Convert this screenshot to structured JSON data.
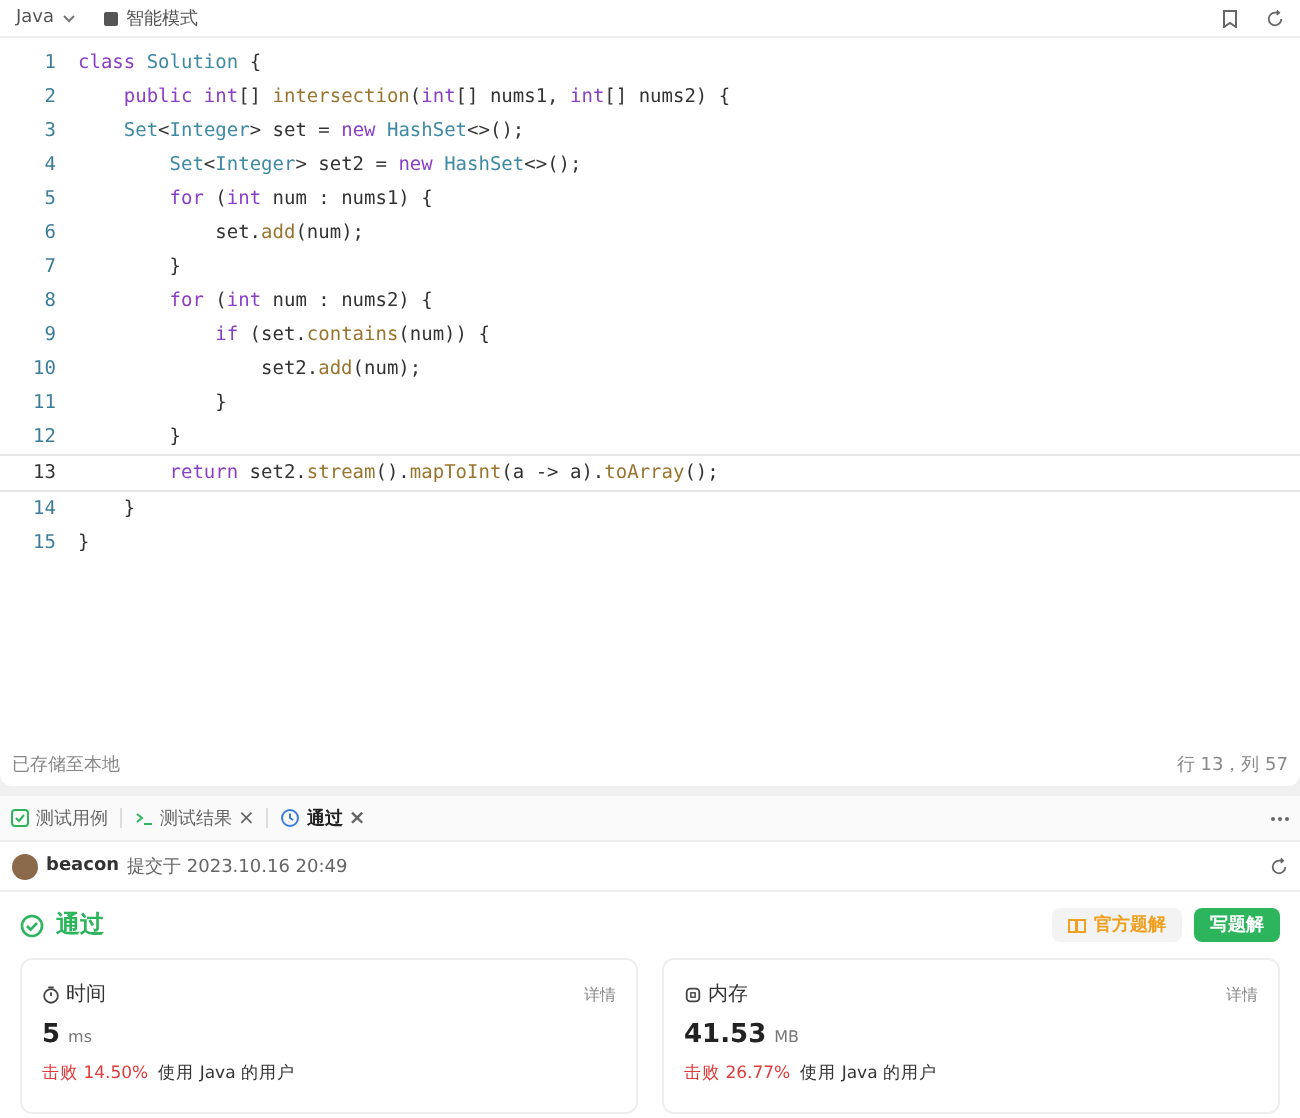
{
  "toolbar": {
    "language": "Java",
    "mode": "智能模式"
  },
  "editor": {
    "lines": [
      {
        "number": "1",
        "selected": false,
        "tokens": [
          {
            "kind": "keyword",
            "text": "class "
          },
          {
            "kind": "type",
            "text": "Solution"
          },
          {
            "kind": "plain",
            "text": " {"
          }
        ]
      },
      {
        "number": "2",
        "selected": false,
        "tokens": [
          {
            "kind": "keyword",
            "text": "    public int"
          },
          {
            "kind": "plain",
            "text": "[] "
          },
          {
            "kind": "method",
            "text": "intersection"
          },
          {
            "kind": "plain",
            "text": "("
          },
          {
            "kind": "keyword",
            "text": "int"
          },
          {
            "kind": "plain",
            "text": "[] nums1, "
          },
          {
            "kind": "keyword",
            "text": "int"
          },
          {
            "kind": "plain",
            "text": "[] nums2) {"
          }
        ]
      },
      {
        "number": "3",
        "selected": false,
        "tokens": [
          {
            "kind": "type",
            "text": "    Set"
          },
          {
            "kind": "plain",
            "text": "<"
          },
          {
            "kind": "type",
            "text": "Integer"
          },
          {
            "kind": "plain",
            "text": "> set = "
          },
          {
            "kind": "keyword",
            "text": "new "
          },
          {
            "kind": "type",
            "text": "HashSet"
          },
          {
            "kind": "plain",
            "text": "<>();"
          }
        ]
      },
      {
        "number": "4",
        "selected": false,
        "tokens": [
          {
            "kind": "type",
            "text": "        Set"
          },
          {
            "kind": "plain",
            "text": "<"
          },
          {
            "kind": "type",
            "text": "Integer"
          },
          {
            "kind": "plain",
            "text": "> set2 = "
          },
          {
            "kind": "keyword",
            "text": "new "
          },
          {
            "kind": "type",
            "text": "HashSet"
          },
          {
            "kind": "plain",
            "text": "<>();"
          }
        ]
      },
      {
        "number": "5",
        "selected": false,
        "tokens": [
          {
            "kind": "keyword",
            "text": "        for"
          },
          {
            "kind": "plain",
            "text": " ("
          },
          {
            "kind": "keyword",
            "text": "int"
          },
          {
            "kind": "plain",
            "text": " num : nums1) {"
          }
        ]
      },
      {
        "number": "6",
        "selected": false,
        "tokens": [
          {
            "kind": "plain",
            "text": "            set."
          },
          {
            "kind": "method",
            "text": "add"
          },
          {
            "kind": "plain",
            "text": "(num);"
          }
        ]
      },
      {
        "number": "7",
        "selected": false,
        "tokens": [
          {
            "kind": "plain",
            "text": "        }"
          }
        ]
      },
      {
        "number": "8",
        "selected": false,
        "tokens": [
          {
            "kind": "keyword",
            "text": "        for"
          },
          {
            "kind": "plain",
            "text": " ("
          },
          {
            "kind": "keyword",
            "text": "int"
          },
          {
            "kind": "plain",
            "text": " num : nums2) {"
          }
        ]
      },
      {
        "number": "9",
        "selected": false,
        "tokens": [
          {
            "kind": "keyword",
            "text": "            if"
          },
          {
            "kind": "plain",
            "text": " (set."
          },
          {
            "kind": "method",
            "text": "contains"
          },
          {
            "kind": "plain",
            "text": "(num)) {"
          }
        ]
      },
      {
        "number": "10",
        "selected": false,
        "tokens": [
          {
            "kind": "plain",
            "text": "                set2."
          },
          {
            "kind": "method",
            "text": "add"
          },
          {
            "kind": "plain",
            "text": "(num);"
          }
        ]
      },
      {
        "number": "11",
        "selected": false,
        "tokens": [
          {
            "kind": "plain",
            "text": "            }"
          }
        ]
      },
      {
        "number": "12",
        "selected": false,
        "tokens": [
          {
            "kind": "plain",
            "text": "        }"
          }
        ]
      },
      {
        "number": "13",
        "selected": true,
        "tokens": [
          {
            "kind": "keyword",
            "text": "        return"
          },
          {
            "kind": "plain",
            "text": " set2."
          },
          {
            "kind": "method",
            "text": "stream"
          },
          {
            "kind": "plain",
            "text": "()."
          },
          {
            "kind": "method",
            "text": "mapToInt"
          },
          {
            "kind": "plain",
            "text": "(a -> a)."
          },
          {
            "kind": "method",
            "text": "toArray"
          },
          {
            "kind": "plain",
            "text": "();"
          }
        ]
      },
      {
        "number": "14",
        "selected": false,
        "tokens": [
          {
            "kind": "plain",
            "text": "    }"
          }
        ]
      },
      {
        "number": "15",
        "selected": false,
        "tokens": [
          {
            "kind": "plain",
            "text": "}"
          }
        ]
      }
    ]
  },
  "status_bar": {
    "saved": "已存储至本地",
    "cursor": "行 13，列 57"
  },
  "tabs": [
    {
      "label": "测试用例",
      "selected": false
    },
    {
      "label": "测试结果",
      "close": "×",
      "selected": false
    },
    {
      "label": "通过",
      "close": "×",
      "selected": true
    }
  ],
  "submission": {
    "user": "beacon",
    "submitted": "提交于 2023.10.16 20:49"
  },
  "result": {
    "status": "通过",
    "buttons": [
      {
        "label": "官方题解",
        "kind": "secondary"
      },
      {
        "label": "写题解",
        "kind": "primary"
      }
    ]
  },
  "cards": [
    {
      "title": "时间",
      "detail": "详情",
      "value": "5",
      "unit": "ms",
      "beats": "击败 14.50%",
      "note": "使用 Java 的用户"
    },
    {
      "title": "内存",
      "detail": "详情",
      "value": "41.53",
      "unit": "MB",
      "beats": "击败 26.77%",
      "note": "使用 Java 的用户"
    }
  ]
}
